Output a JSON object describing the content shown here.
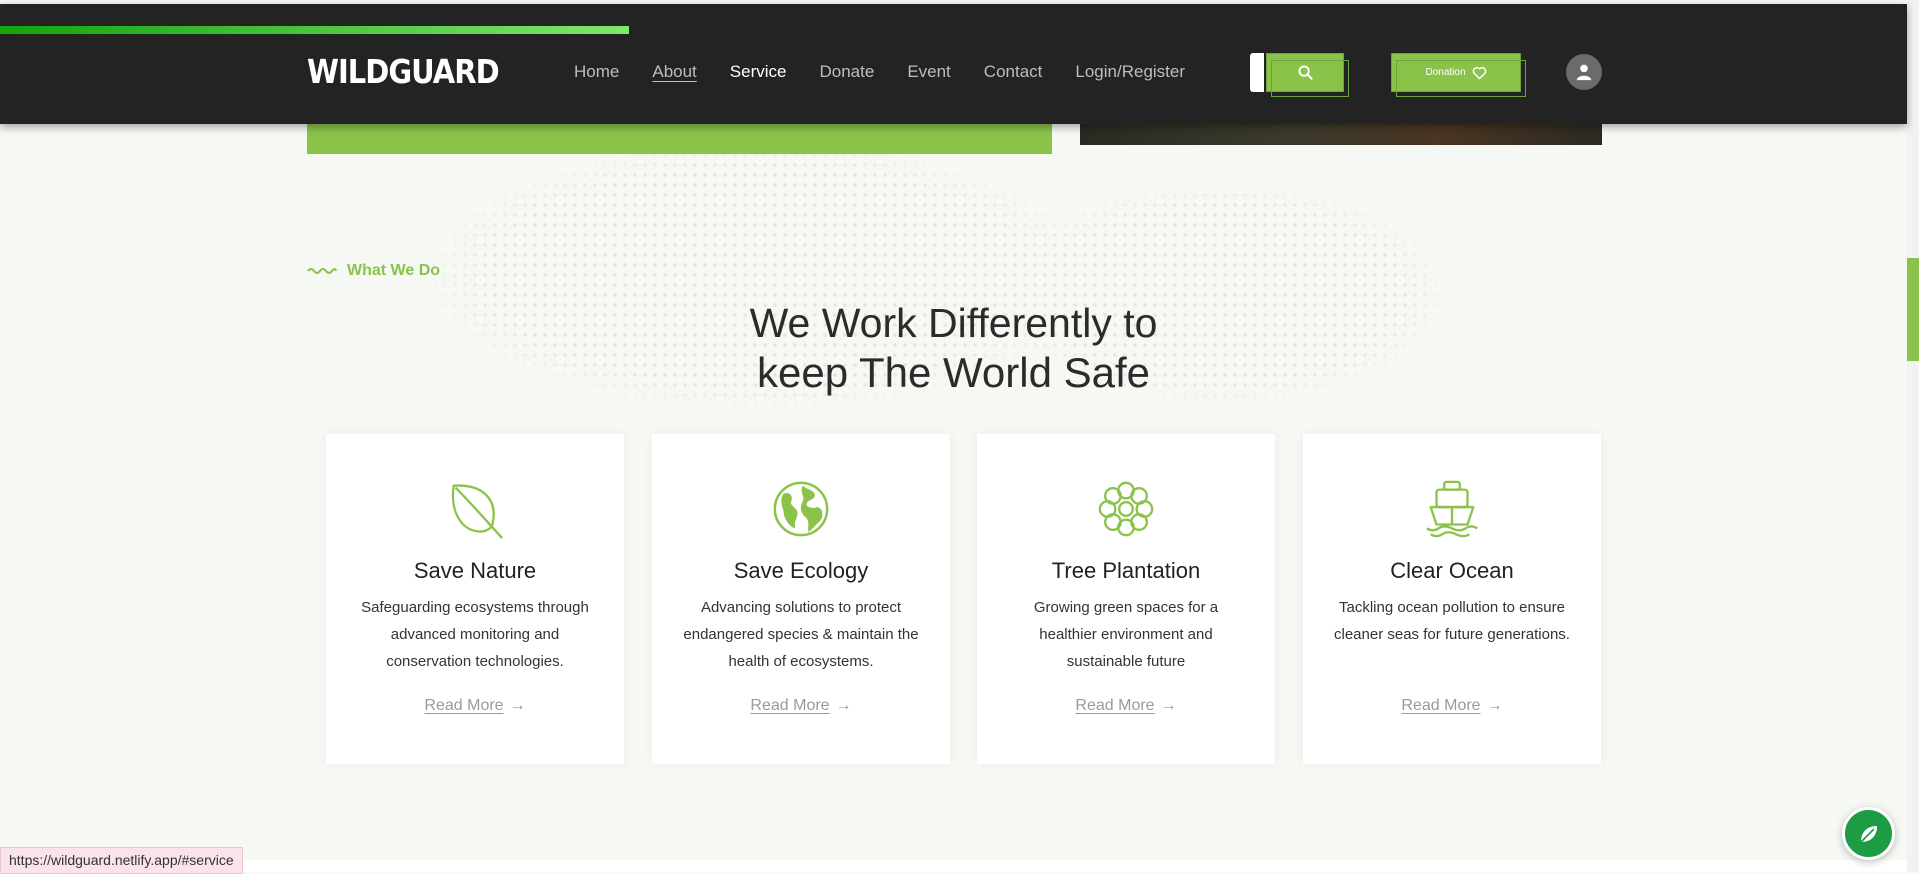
{
  "header": {
    "logo": "WILDGUARD",
    "scroll_progress": 0.33,
    "nav": [
      "Home",
      "About",
      "Service",
      "Donate",
      "Event",
      "Contact",
      "Login/Register"
    ],
    "active_nav": "Service",
    "donation_label": "Donation"
  },
  "section": {
    "eyebrow": "What We Do",
    "headline_line1": "We Work Differently to",
    "headline_line2": "keep The World Safe"
  },
  "cards": [
    {
      "title": "Save Nature",
      "text": "Safeguarding ecosystems through advanced monitoring and conservation technologies.",
      "link": "Read More",
      "icon": "leaf-icon"
    },
    {
      "title": "Save Ecology",
      "text": "Advancing solutions to protect endangered species & maintain the health of ecosystems.",
      "link": "Read More",
      "icon": "globe-icon"
    },
    {
      "title": "Tree Plantation",
      "text": "Growing green spaces for a healthier environment and sustainable future",
      "link": "Read More",
      "icon": "flower-icon"
    },
    {
      "title": "Clear Ocean",
      "text": "Tackling ocean pollution to ensure cleaner seas for future generations.",
      "link": "Read More",
      "icon": "ship-icon"
    }
  ],
  "status_url": "https://wildguard.netlify.app/#service",
  "colors": {
    "accent": "#8bc34a",
    "header_bg": "#232323",
    "page_bg": "#f6f8f3",
    "fab": "#1e9b45"
  }
}
